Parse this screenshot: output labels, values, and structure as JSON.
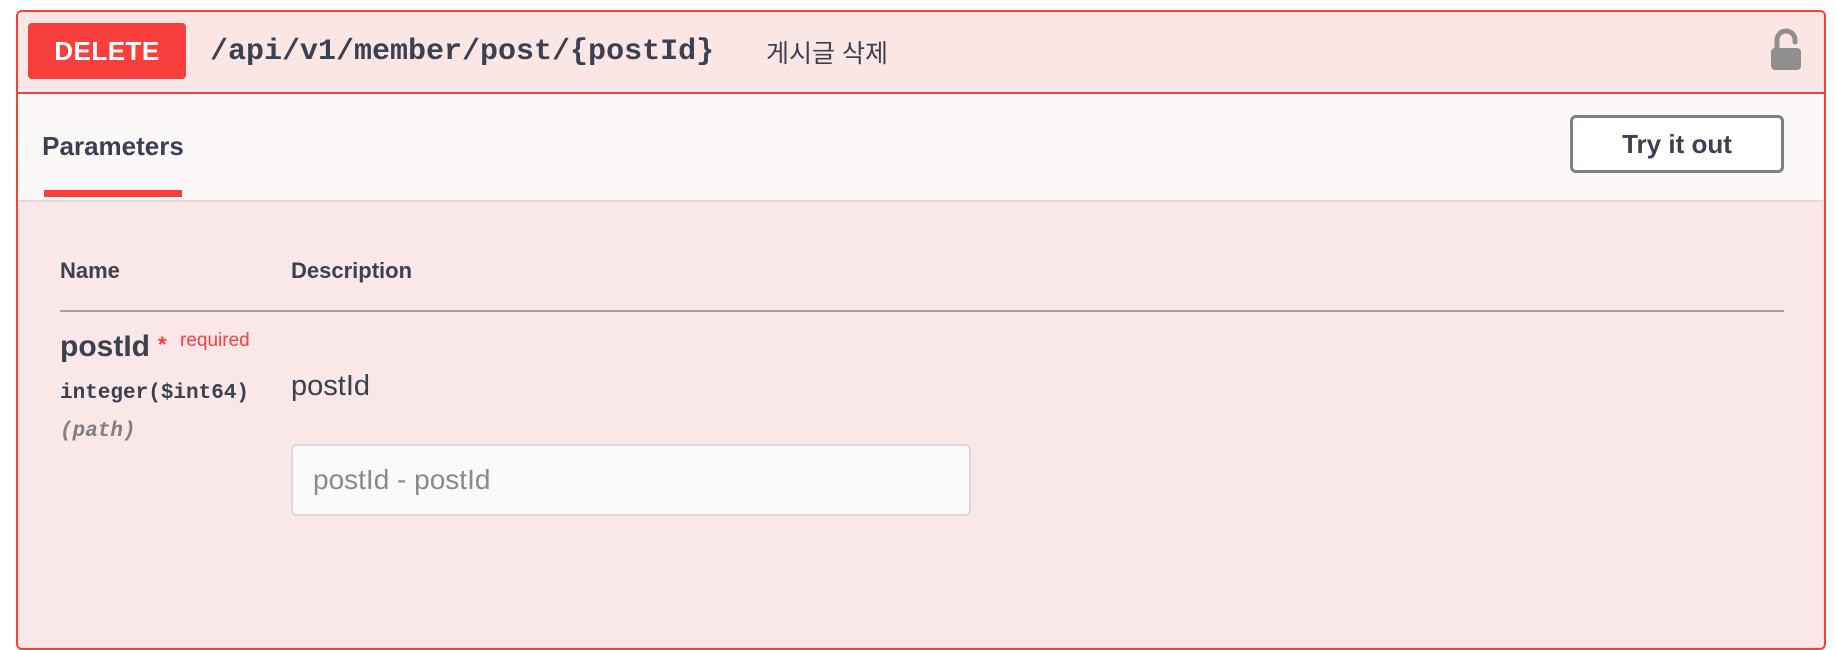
{
  "operation": {
    "method": "DELETE",
    "path": "/api/v1/member/post/{postId}",
    "summary": "게시글 삭제",
    "lock_icon": "unlocked-padlock-icon"
  },
  "tabs": {
    "parameters_label": "Parameters",
    "try_it_out_label": "Try it out"
  },
  "table": {
    "col_name": "Name",
    "col_description": "Description"
  },
  "parameter": {
    "name": "postId",
    "required_marker": "*",
    "required_label": "required",
    "type": "integer($int64)",
    "in": "(path)",
    "description": "postId",
    "input_placeholder": "postId - postId",
    "input_value": ""
  },
  "colors": {
    "accent": "#f93e3e",
    "block_bg": "#fae7e7",
    "text": "#3b4151"
  }
}
